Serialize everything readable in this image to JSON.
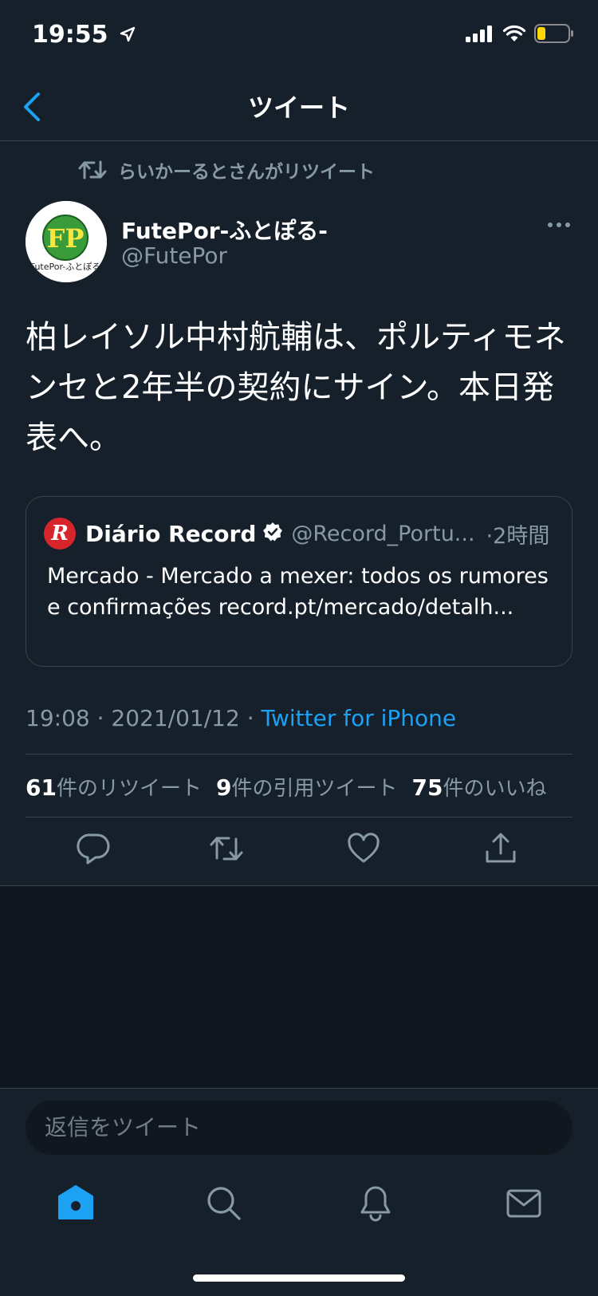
{
  "status_bar": {
    "time": "19:55"
  },
  "nav": {
    "title": "ツイート"
  },
  "retweet_context": {
    "label": "らいかーるとさんがリツイート"
  },
  "author": {
    "name": "FutePor-ふとぽる-",
    "handle": "@FutePor",
    "avatar_initials": "FP",
    "avatar_caption": "FutePor-ふとぽる"
  },
  "tweet": {
    "text": "柏レイソル中村航輔は、ポルティモネンセと2年半の契約にサイン。本日発表へ。"
  },
  "quoted_tweet": {
    "logo_letter": "R",
    "name": "Diário Record",
    "handle": "@Record_Portu...",
    "time": "·2時間",
    "text": "Mercado - Mercado a mexer: todos os rumores e confirmações record.pt/mercado/detalh..."
  },
  "meta": {
    "time": "19:08",
    "separator1": " · ",
    "date": "2021/01/12",
    "separator2": " · ",
    "source": "Twitter for iPhone"
  },
  "stats": {
    "retweets_count": "61",
    "retweets_label": "件のリツイート",
    "quotes_count": "9",
    "quotes_label": "件の引用ツイート",
    "likes_count": "75",
    "likes_label": "件のいいね"
  },
  "reply": {
    "placeholder": "返信をツイート"
  },
  "icons": {
    "back": "chevron-left-icon",
    "retweet_context": "retweet-icon",
    "more": "more-horizontal-icon",
    "verified": "verified-badge-icon",
    "reply": "reply-icon",
    "retweet": "retweet-icon",
    "like": "heart-icon",
    "share": "share-icon",
    "home": "home-icon",
    "search": "search-icon",
    "notifications": "bell-icon",
    "messages": "mail-icon"
  },
  "colors": {
    "background": "#15202b",
    "accent": "#1da1f2",
    "secondary_text": "#8899a6",
    "divider": "#38444d",
    "battery_low": "#ffd60a"
  }
}
